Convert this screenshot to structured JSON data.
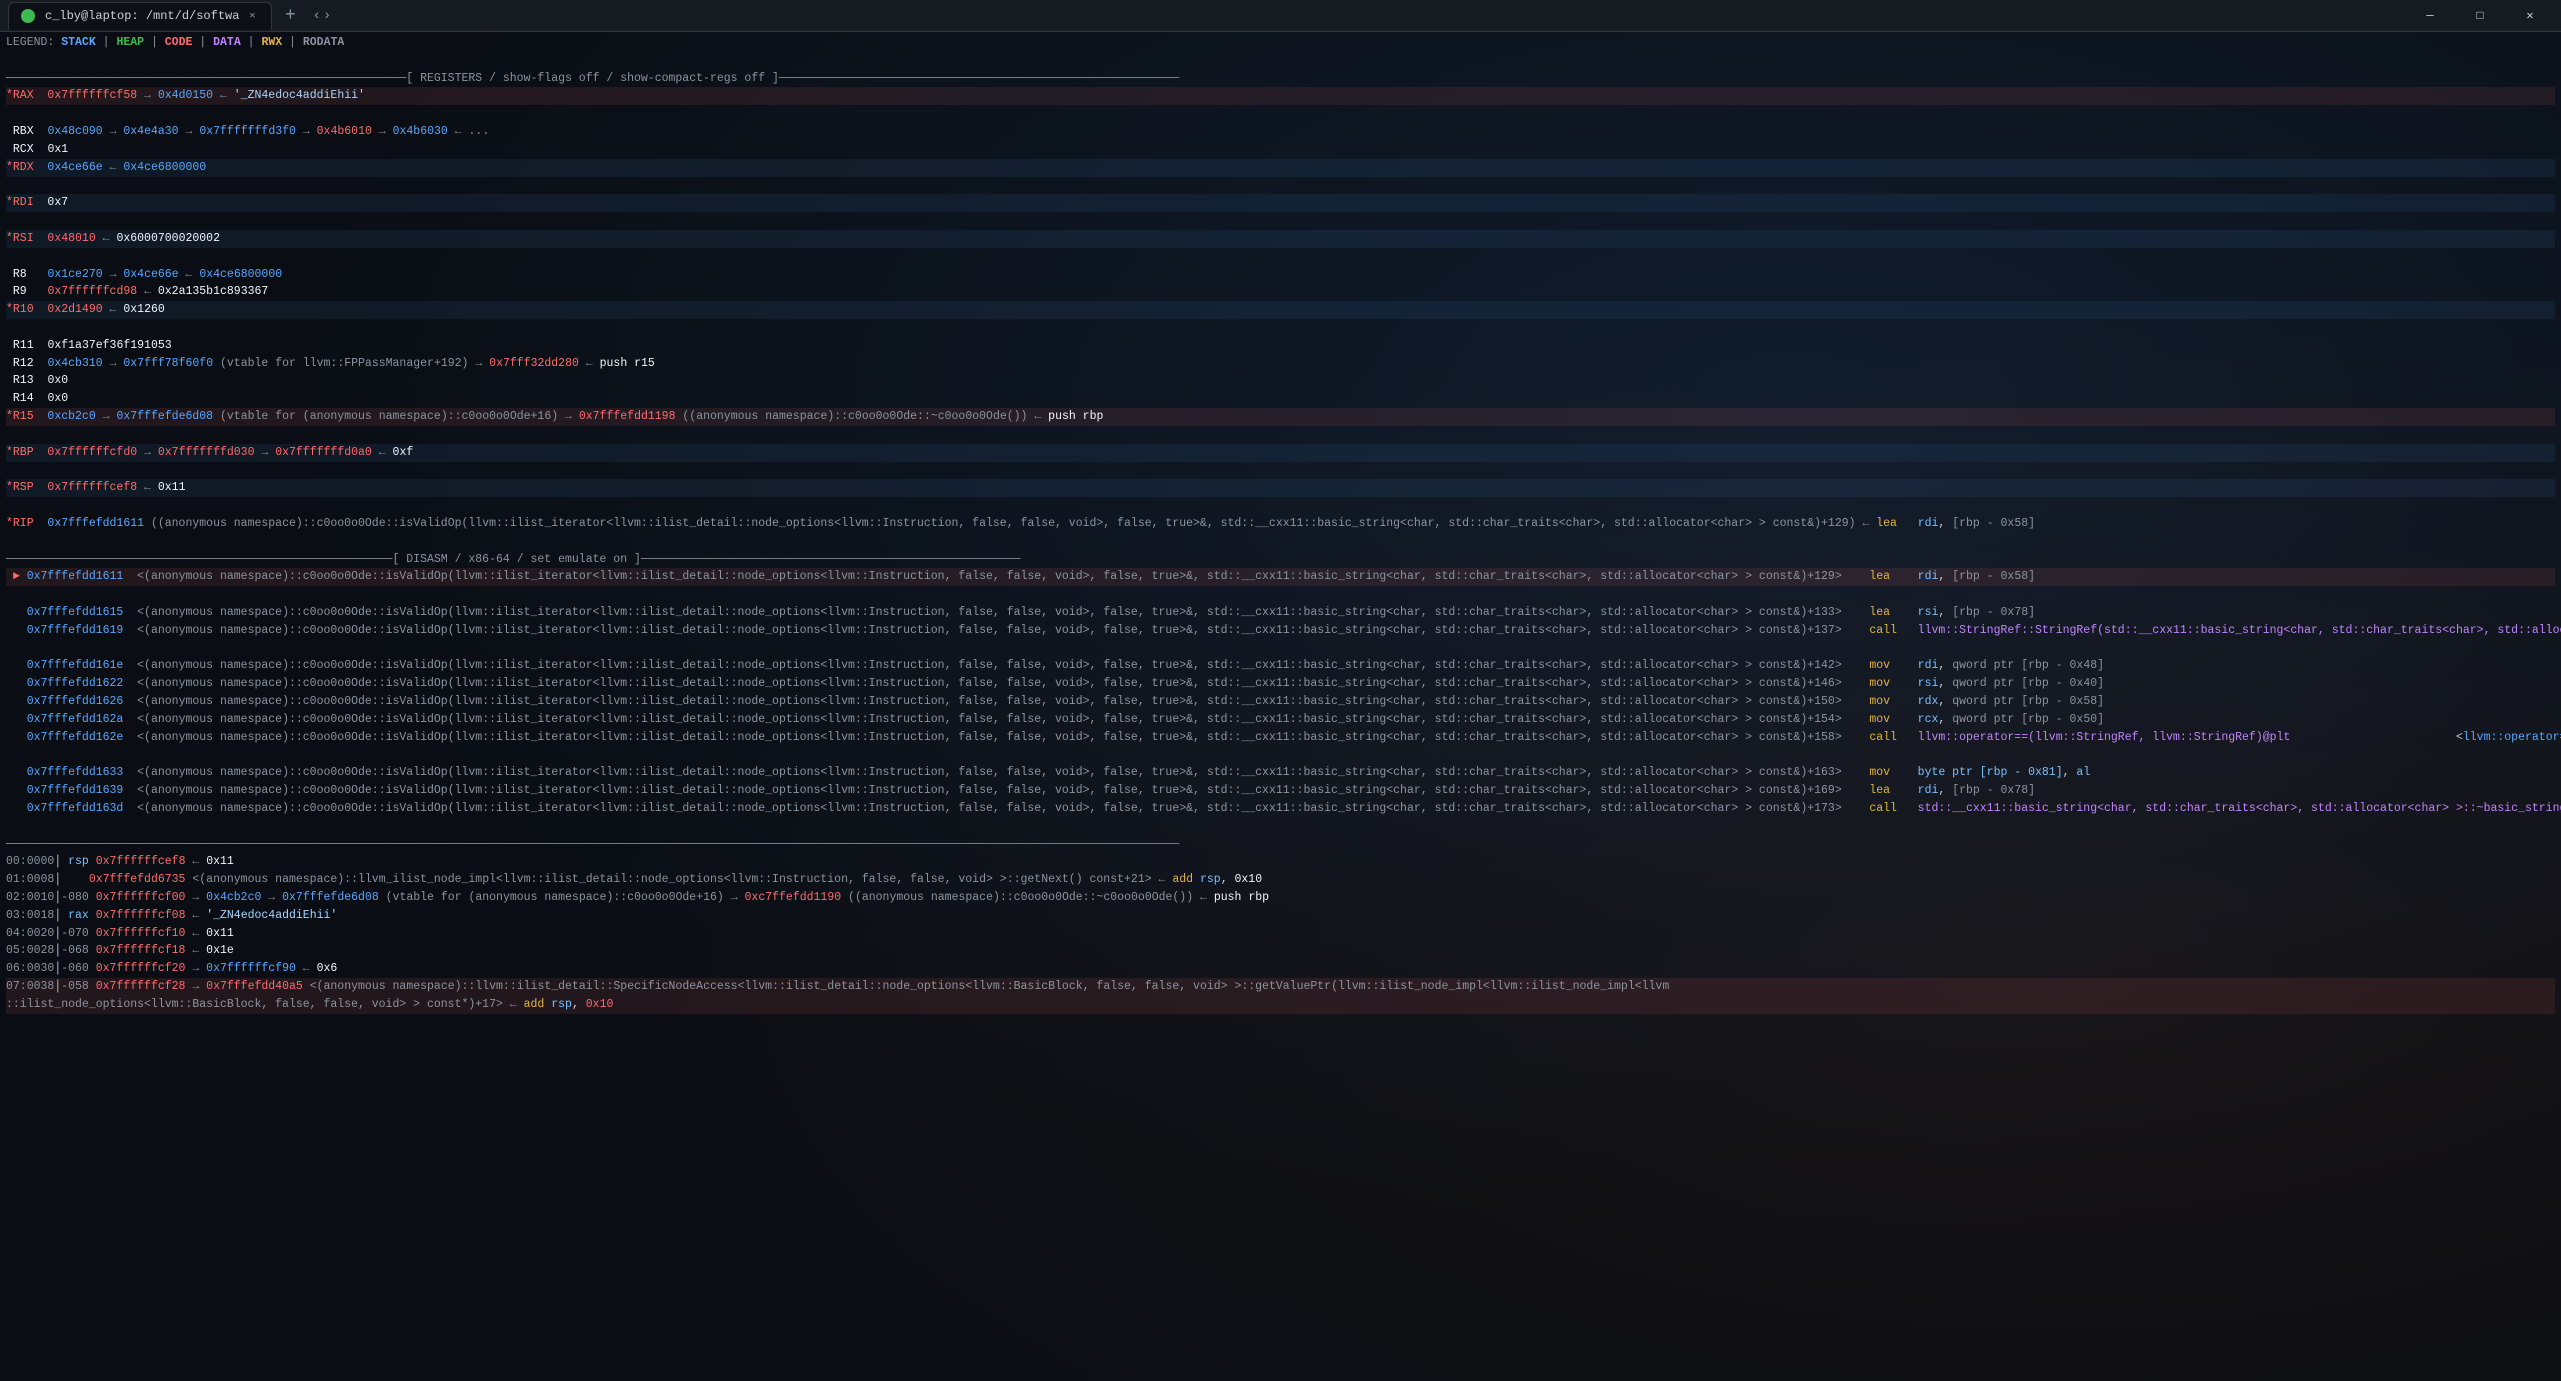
{
  "window": {
    "title": "c_lby@laptop: /mnt/d/softwa",
    "favicon": "terminal"
  },
  "legend": {
    "label": "LEGEND:",
    "items": [
      {
        "name": "STACK",
        "color": "stack"
      },
      {
        "name": "HEAP",
        "color": "heap"
      },
      {
        "name": "CODE",
        "color": "code"
      },
      {
        "name": "DATA",
        "color": "data"
      },
      {
        "name": "RWX",
        "color": "rwx"
      },
      {
        "name": "RODATA",
        "color": "rodata"
      }
    ]
  },
  "registers_header": "─────────────────────────────────────────────────────────[ REGISTERS / show-flags off / show-compact-regs off ]──────────────────────────────────────────────────────────",
  "window_controls": {
    "minimize": "─",
    "maximize": "□",
    "close": "✕"
  }
}
